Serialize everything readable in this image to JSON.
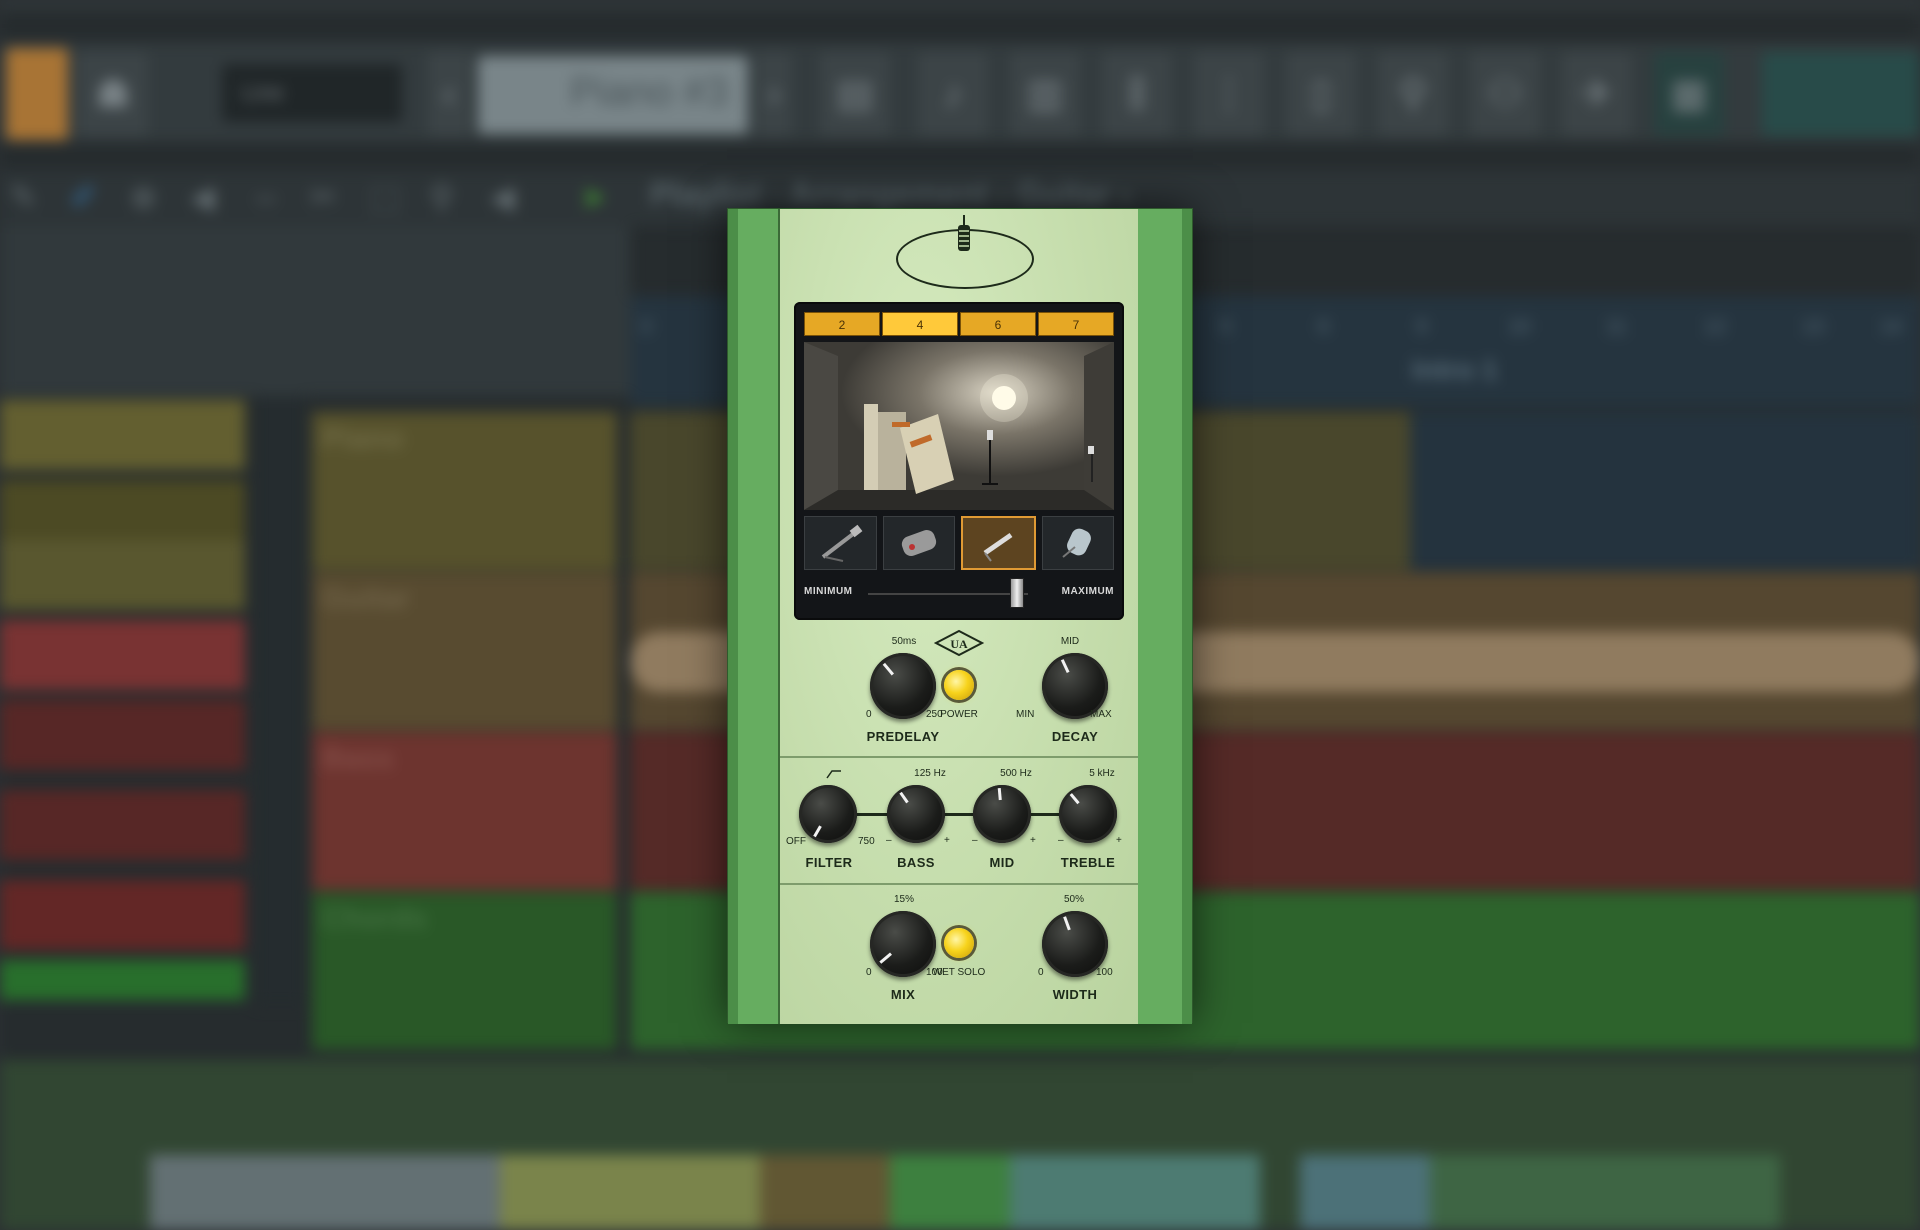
{
  "daw": {
    "pattern_label": "Piano #3",
    "dropdown_label": "Line",
    "playlist_title": "Playlist - Arrangement › Guitar ›",
    "ruler_numbers": [
      "3",
      "5",
      "6",
      "9",
      "10",
      "11",
      "12",
      "13",
      "14"
    ],
    "tracks": [
      {
        "name": "Piano",
        "color": "#6c6331"
      },
      {
        "name": "Guitar",
        "color": "#6e5a36"
      },
      {
        "name": "Bass",
        "color": "#8a3b34"
      },
      {
        "name": "Chords",
        "color": "#2f6b2a"
      }
    ],
    "marker_label": "Intro 1"
  },
  "plugin": {
    "colors": {
      "rail": "#5ea55a",
      "faceplate": "#c9e1b1",
      "tab": "#e6a825",
      "led": "#f7d31c"
    },
    "room_tabs": [
      "2",
      "4",
      "6",
      "7"
    ],
    "active_tab": "4",
    "mic_options": [
      "ribbon-mic-icon",
      "condenser-mic-icon",
      "pencil-mic-icon",
      "tube-mic-icon"
    ],
    "active_mic": 3,
    "distance": {
      "min_label": "MINIMUM",
      "max_label": "MAXIMUM",
      "value": 0.93
    },
    "predelay": {
      "label": "PREDELAY",
      "top": "50ms",
      "min": "0",
      "max": "250"
    },
    "power": {
      "label": "POWER"
    },
    "decay": {
      "label": "DECAY",
      "top": "MID",
      "min": "MIN",
      "max": "MAX"
    },
    "filter": {
      "label": "FILTER",
      "min": "OFF",
      "max": "750"
    },
    "bass": {
      "label": "BASS",
      "top": "125 Hz",
      "min": "–",
      "max": "+"
    },
    "mid": {
      "label": "MID",
      "top": "500 Hz",
      "min": "–",
      "max": "+"
    },
    "treble": {
      "label": "TREBLE",
      "top": "5 kHz",
      "min": "–",
      "max": "+"
    },
    "mix": {
      "label": "MIX",
      "top": "15%",
      "min": "0",
      "max": "100"
    },
    "wet_solo": {
      "label": "WET SOLO"
    },
    "width": {
      "label": "WIDTH",
      "top": "50%",
      "min": "0",
      "max": "100"
    }
  }
}
